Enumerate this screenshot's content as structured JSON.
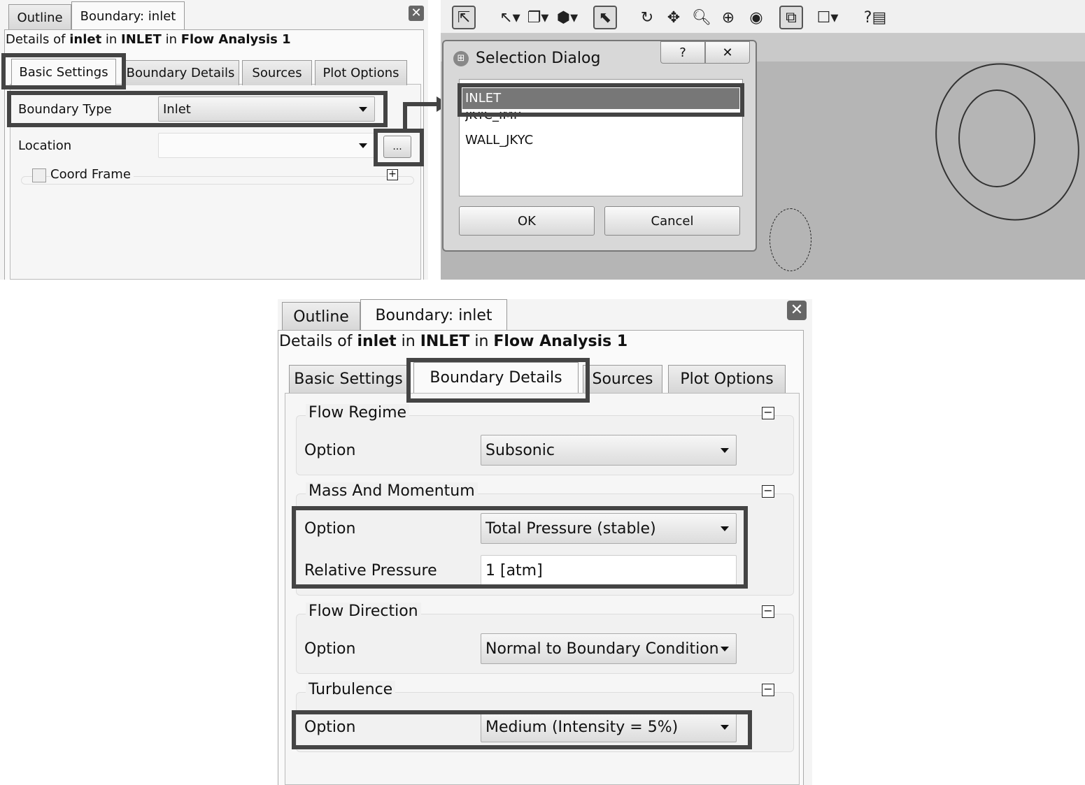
{
  "top_panel": {
    "tabs": [
      "Outline",
      "Boundary: inlet"
    ],
    "details": {
      "prefix": "Details of ",
      "obj": "inlet",
      "in1": " in ",
      "domain": "INLET",
      "in2": " in ",
      "analysis": "Flow Analysis 1"
    },
    "subtabs": [
      "Basic Settings",
      "Boundary Details",
      "Sources",
      "Plot Options"
    ],
    "active_subtab": "Basic Settings",
    "boundary_type_label": "Boundary Type",
    "boundary_type_value": "Inlet",
    "location_label": "Location",
    "location_value": "",
    "ellipsis_label": "...",
    "coord_frame_label": "Coord Frame",
    "coord_frame_checked": false
  },
  "toolbar": {
    "icons": [
      "select-icon",
      "pointer-icon",
      "box-select-icon",
      "3d-box-icon",
      "picker-icon",
      "rotate-icon",
      "pan-icon",
      "zoom-icon",
      "zoom-box-icon",
      "zoom-fit-icon",
      "fit-view-icon",
      "frame-icon",
      "help-icon"
    ]
  },
  "selection_dialog": {
    "title": "Selection Dialog",
    "help_label": "?",
    "items": [
      "INLET",
      "JKYC_IMP",
      "WALL_JKYC"
    ],
    "selected": "INLET",
    "ok_label": "OK",
    "cancel_label": "Cancel"
  },
  "bottom_panel": {
    "tabs": [
      "Outline",
      "Boundary: inlet"
    ],
    "details": {
      "prefix": "Details of ",
      "obj": "inlet",
      "in1": " in ",
      "domain": "INLET",
      "in2": " in ",
      "analysis": "Flow Analysis 1"
    },
    "subtabs": [
      "Basic Settings",
      "Boundary Details",
      "Sources",
      "Plot Options"
    ],
    "active_subtab": "Boundary Details",
    "groups": [
      {
        "title": "Flow Regime",
        "rows": [
          {
            "label": "Option",
            "value": "Subsonic"
          }
        ]
      },
      {
        "title": "Mass And Momentum",
        "rows": [
          {
            "label": "Option",
            "value": "Total Pressure (stable)"
          },
          {
            "label": "Relative Pressure",
            "value": "1 [atm]"
          }
        ]
      },
      {
        "title": "Flow Direction",
        "rows": [
          {
            "label": "Option",
            "value": "Normal to Boundary Condition"
          }
        ]
      },
      {
        "title": "Turbulence",
        "rows": [
          {
            "label": "Option",
            "value": "Medium (Intensity = 5%)"
          }
        ]
      }
    ]
  }
}
